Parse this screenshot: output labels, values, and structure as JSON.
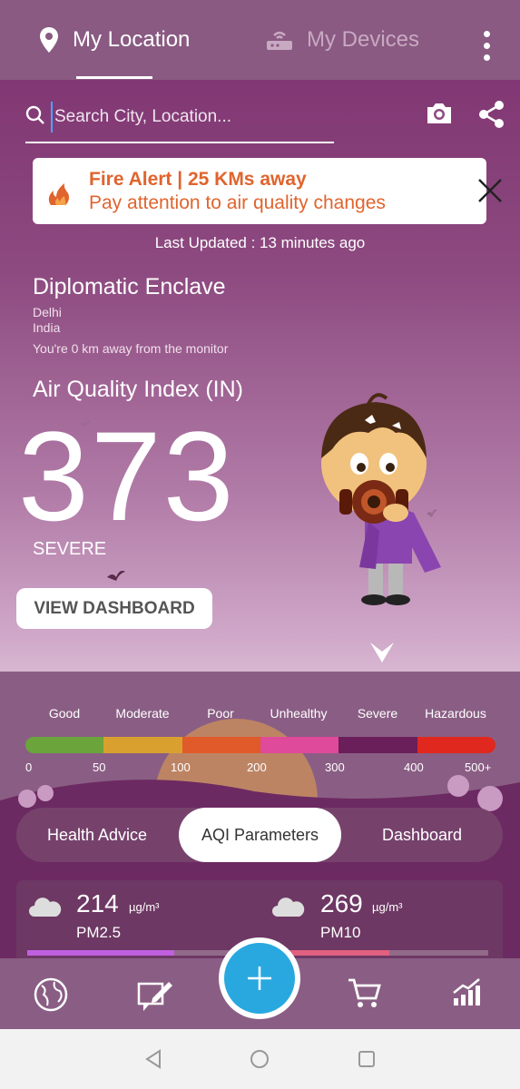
{
  "tabs": {
    "my_location": "My Location",
    "my_devices": "My Devices"
  },
  "search": {
    "placeholder": "Search City, Location..."
  },
  "alert": {
    "title": "Fire Alert | 25 KMs away",
    "subtitle": "Pay attention to air quality changes",
    "color": "#e0642e"
  },
  "last_updated": "Last Updated : 13 minutes ago",
  "location": {
    "name": "Diplomatic Enclave",
    "city": "Delhi",
    "country": "India",
    "distance": "You're 0 km away from the monitor"
  },
  "aqi": {
    "label": "Air Quality Index (IN)",
    "value": "373",
    "status": "SEVERE"
  },
  "view_dashboard": "VIEW DASHBOARD",
  "scale": {
    "categories": [
      "Good",
      "Moderate",
      "Poor",
      "Unhealthy",
      "Severe",
      "Hazardous"
    ],
    "colors": [
      "#6aa43a",
      "#d9a030",
      "#e05a2a",
      "#e04a9a",
      "#6a1e5a",
      "#e0281e"
    ],
    "ticks": [
      "0",
      "50",
      "100",
      "200",
      "300",
      "400",
      "500+"
    ]
  },
  "segments": {
    "health_advice": "Health Advice",
    "aqi_parameters": "AQI Parameters",
    "dashboard": "Dashboard"
  },
  "params": {
    "pm25": {
      "value": "214",
      "unit": "µg/m³",
      "name": "PM2.5",
      "bar_color": "#c060e0",
      "level": 0.68
    },
    "pm10": {
      "value": "269",
      "unit": "µg/m³",
      "name": "PM10",
      "bar_color": "#e06080",
      "level": 0.54
    }
  },
  "bottom_nav": {
    "icons": [
      "globe-icon",
      "edit-icon",
      "add-icon",
      "cart-icon",
      "chart-icon"
    ]
  }
}
